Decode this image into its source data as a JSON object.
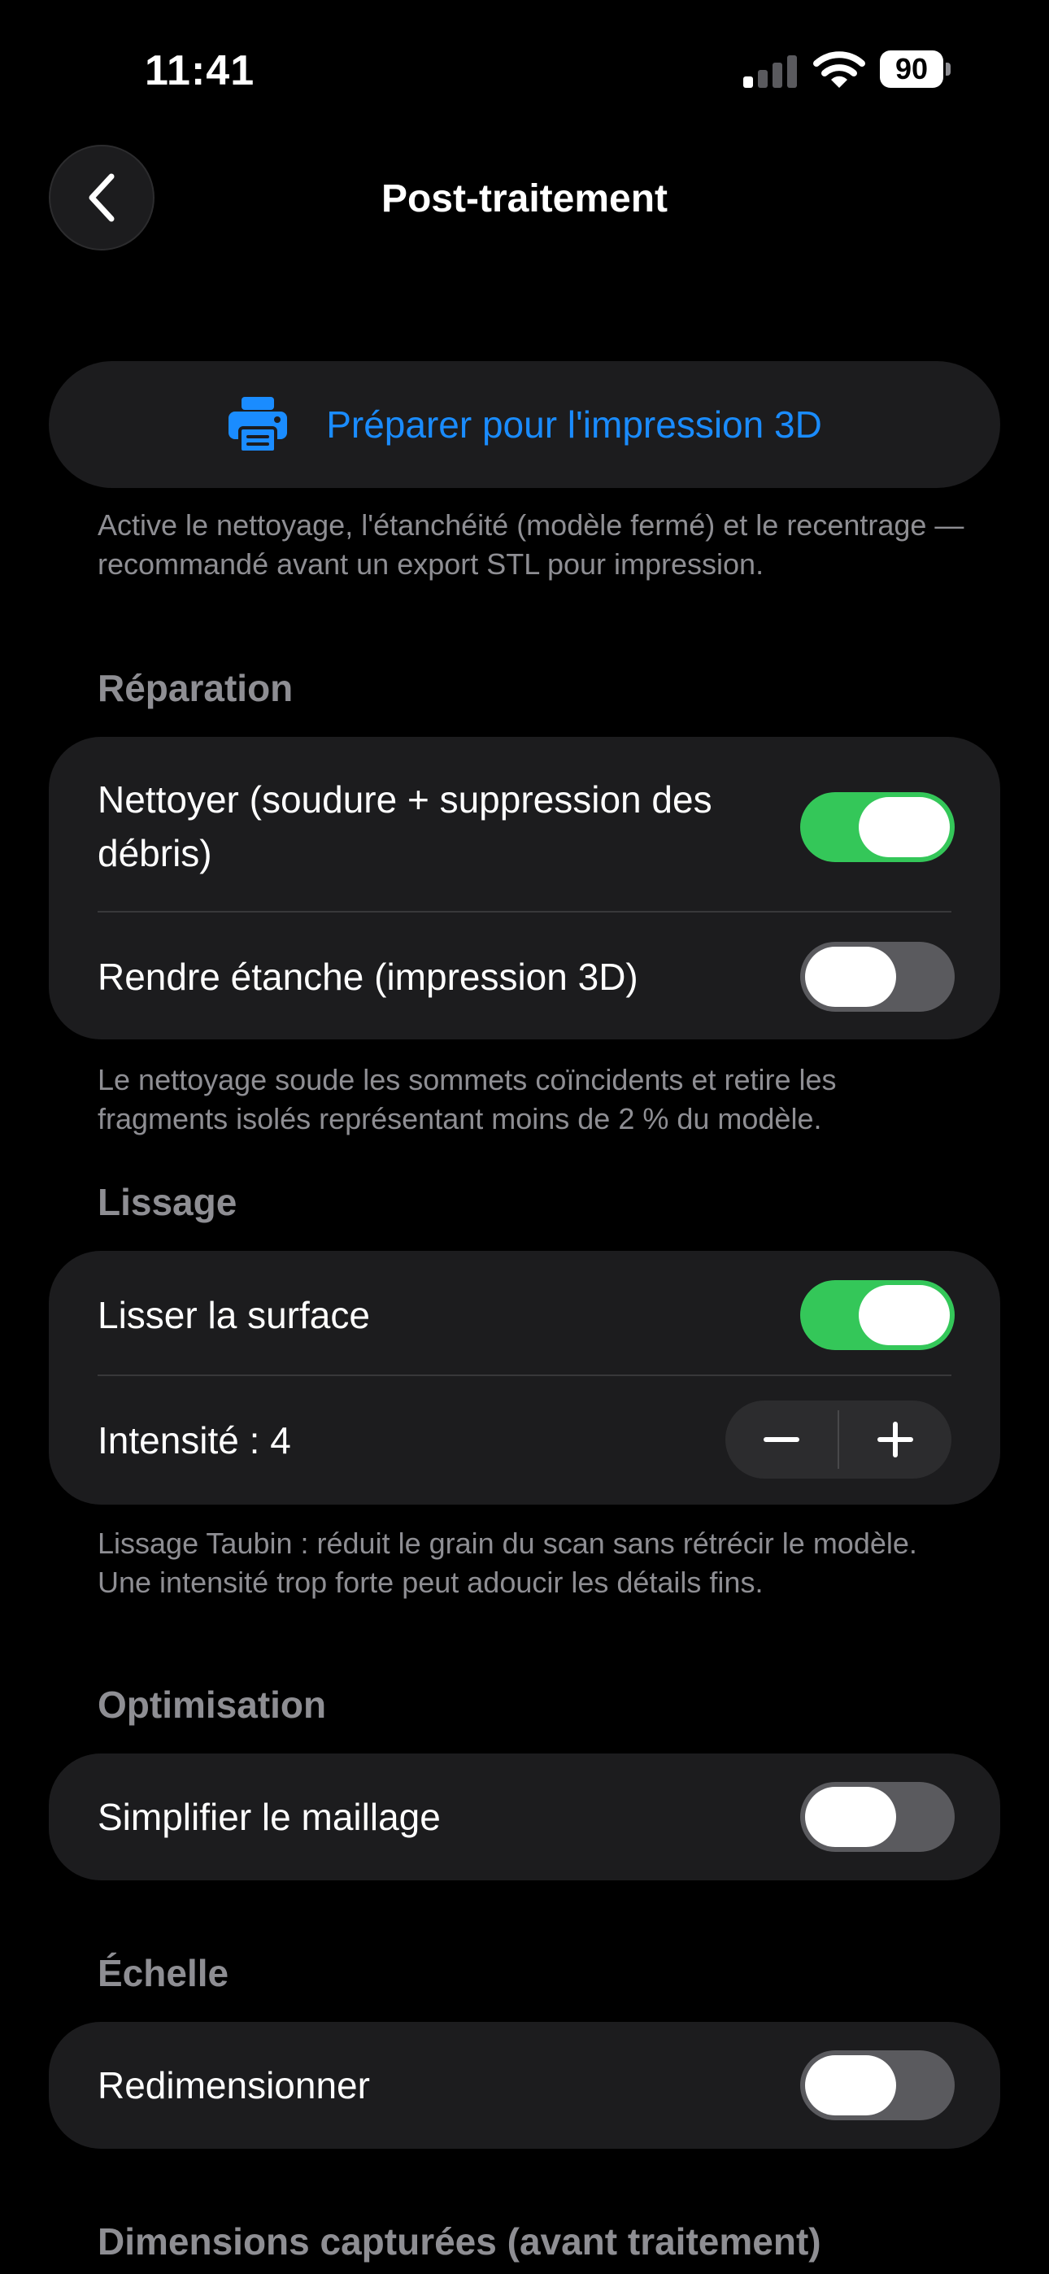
{
  "status_bar": {
    "time": "11:41",
    "battery_level": "90",
    "signal_bars_active": 1,
    "icons": [
      "signal-icon",
      "wifi-icon",
      "battery-icon"
    ]
  },
  "nav": {
    "title": "Post-traitement",
    "back_icon": "chevron-left-icon"
  },
  "prepare_button": {
    "label": "Préparer pour l'impression 3D",
    "icon": "printer-icon",
    "color": "#1a8cff"
  },
  "prepare_footer": "Active le nettoyage, l'étanchéité (modèle fermé) et le recentrage — recommandé avant un export STL pour impression.",
  "sections": {
    "repair": {
      "header": "Réparation",
      "rows": [
        {
          "label": "Nettoyer (soudure + suppression des débris)",
          "toggle_on": true
        },
        {
          "label": "Rendre étanche (impression 3D)",
          "toggle_on": false
        }
      ],
      "footer": "Le nettoyage soude les sommets coïncidents et retire les fragments isolés représentant moins de 2 % du modèle."
    },
    "smoothing": {
      "header": "Lissage",
      "toggle_row": {
        "label": "Lisser la surface",
        "toggle_on": true
      },
      "stepper_row": {
        "label": "Intensité : 4",
        "value": 4,
        "minus_icon": "minus-icon",
        "plus_icon": "plus-icon"
      },
      "footer": "Lissage Taubin : réduit le grain du scan sans rétrécir le modèle. Une intensité trop forte peut adoucir les détails fins."
    },
    "optimization": {
      "header": "Optimisation",
      "rows": [
        {
          "label": "Simplifier le maillage",
          "toggle_on": false
        }
      ]
    },
    "scale": {
      "header": "Échelle",
      "rows": [
        {
          "label": "Redimensionner",
          "toggle_on": false
        }
      ]
    },
    "dimensions": {
      "header": "Dimensions capturées (avant traitement)"
    }
  },
  "colors": {
    "background": "#000000",
    "card": "#1c1c1e",
    "accent": "#1a8cff",
    "toggle_on": "#34c759",
    "toggle_off": "#5a5a5e",
    "secondary_text": "#8e8e93"
  }
}
